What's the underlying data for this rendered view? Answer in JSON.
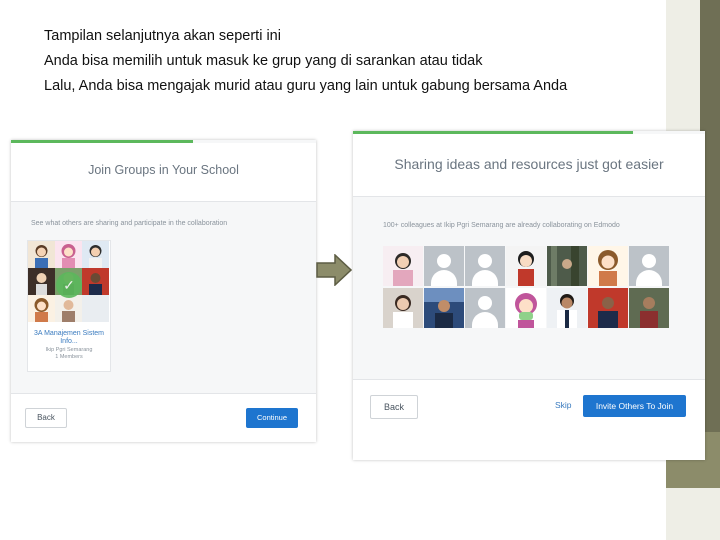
{
  "intro_lines": [
    "Tampilan selanjutnya akan seperti ini",
    "Anda bisa memilih untuk masuk ke grup yang di sarankan atau tidak",
    "Lalu, Anda bisa mengajak murid atau guru yang lain untuk gabung bersama Anda"
  ],
  "panel_left": {
    "title": "Join Groups in Your School",
    "subtitle": "See what others are sharing and participate in the collaboration",
    "group": {
      "name": "3A Manajemen Sistem Info...",
      "school": "Ikip Pgri Semarang",
      "members": "1 Members"
    },
    "back_label": "Back",
    "continue_label": "Continue"
  },
  "panel_right": {
    "title": "Sharing ideas and resources just got easier",
    "subtitle": "100+ colleagues at Ikip Pgri Semarang are already collaborating on Edmodo",
    "back_label": "Back",
    "skip_label": "Skip",
    "invite_label": "Invite Others To Join"
  },
  "colors": {
    "accent_green": "#5cb85c",
    "primary_blue": "#1e75cf",
    "arrow_olive": "#8c8c6a"
  },
  "icons": [
    "check-icon",
    "default-avatar-icon",
    "right-arrow-icon"
  ]
}
